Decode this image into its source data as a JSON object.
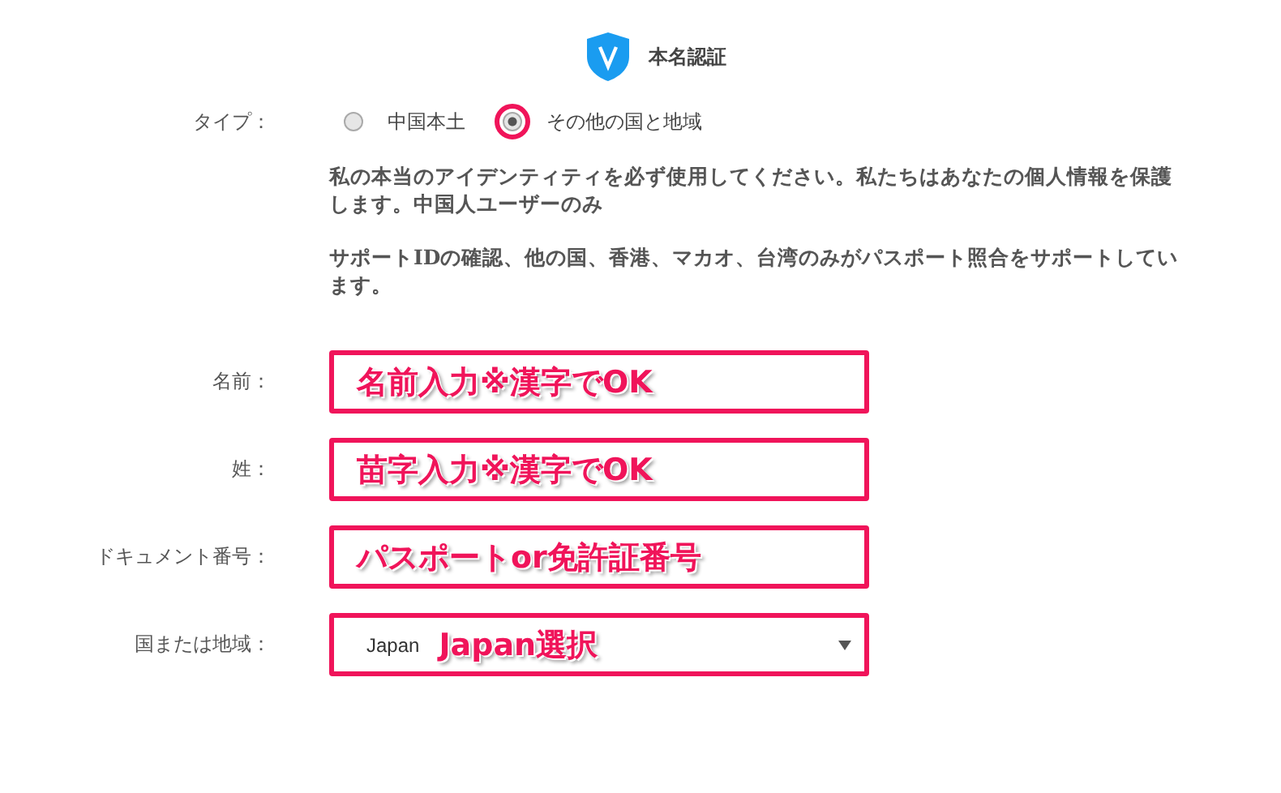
{
  "header": {
    "title": "本名認証"
  },
  "type_row": {
    "label": "タイプ：",
    "options": [
      {
        "label": "中国本土",
        "selected": false,
        "highlighted": false
      },
      {
        "label": "その他の国と地域",
        "selected": true,
        "highlighted": true
      }
    ]
  },
  "notes": [
    "私の本当のアイデンティティを必ず使用してください。私たちはあなたの個人情報を保護します。中国人ユーザーのみ",
    "サポートIDの確認、他の国、香港、マカオ、台湾のみがパスポート照合をサポートしています。"
  ],
  "fields": [
    {
      "kind": "text",
      "label": "名前：",
      "annotation": "名前入力※漢字でOK"
    },
    {
      "kind": "text",
      "label": "姓：",
      "annotation": "苗字入力※漢字でOK"
    },
    {
      "kind": "text",
      "label": "ドキュメント番号：",
      "annotation": "パスポートor免許証番号"
    },
    {
      "kind": "select",
      "label": "国または地域：",
      "value": "Japan",
      "annotation": "Japan選択"
    }
  ]
}
